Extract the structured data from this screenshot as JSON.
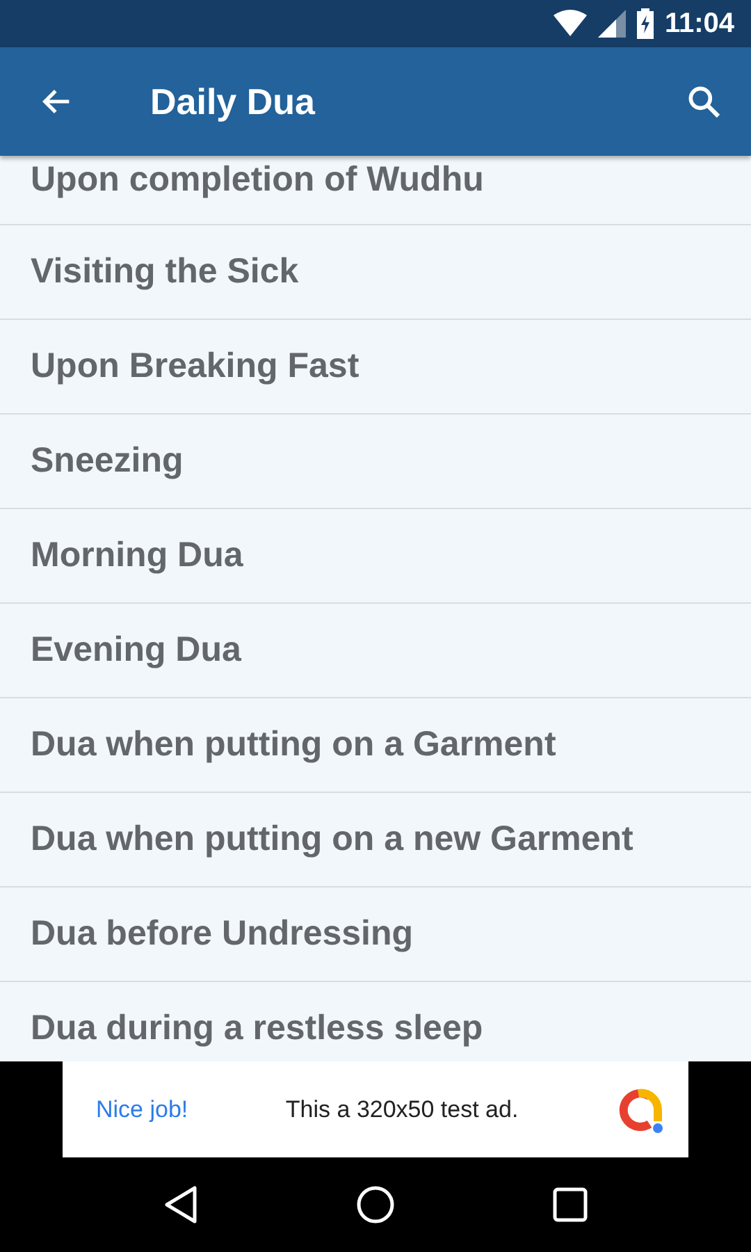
{
  "status_bar": {
    "time": "11:04"
  },
  "app_bar": {
    "title": "Daily Dua"
  },
  "items": [
    {
      "label": "Upon completion of Wudhu"
    },
    {
      "label": "Visiting the Sick"
    },
    {
      "label": "Upon Breaking Fast"
    },
    {
      "label": "Sneezing"
    },
    {
      "label": "Morning Dua"
    },
    {
      "label": "Evening Dua"
    },
    {
      "label": "Dua when putting on a Garment"
    },
    {
      "label": "Dua when putting on a new Garment"
    },
    {
      "label": "Dua before Undressing"
    },
    {
      "label": "Dua during a restless sleep"
    }
  ],
  "ad": {
    "headline": "Nice job!",
    "text": "This a 320x50 test ad."
  }
}
